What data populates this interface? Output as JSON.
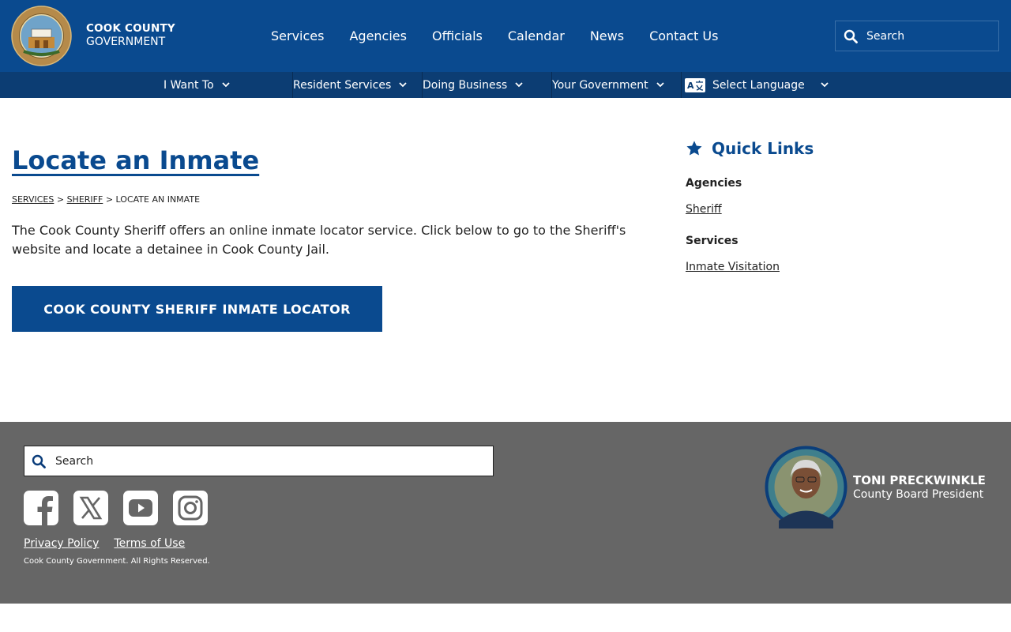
{
  "header": {
    "brand_line1": "COOK COUNTY",
    "brand_line2": "GOVERNMENT",
    "nav": [
      "Services",
      "Agencies",
      "Officials",
      "Calendar",
      "News",
      "Contact Us"
    ],
    "search_placeholder": "Search"
  },
  "subnav": {
    "items": [
      "I Want To",
      "Resident Services",
      "Doing Business",
      "Your Government"
    ],
    "language": "Select Language"
  },
  "main": {
    "title": "Locate an Inmate",
    "breadcrumb": {
      "services": "SERVICES",
      "sep": ">",
      "sheriff": "SHERIFF",
      "current": "LOCATE AN INMATE"
    },
    "intro": "The Cook County Sheriff offers an online inmate locator service. Click below to go to the Sheriff's website and locate a detainee in Cook County Jail.",
    "cta_label": "COOK COUNTY SHERIFF INMATE LOCATOR"
  },
  "quick_links": {
    "title": "Quick Links",
    "agencies_heading": "Agencies",
    "agencies_link": "Sheriff",
    "services_heading": "Services",
    "services_link": "Inmate Visitation"
  },
  "footer": {
    "search_placeholder": "Search",
    "links": [
      "Privacy Policy",
      "Terms of Use"
    ],
    "copyright": "Cook County Government. All Rights Reserved.",
    "president_name": "TONI PRECKWINKLE",
    "president_title": "County Board President"
  },
  "colors": {
    "primary": "#0a4a8f",
    "subnav": "#0c3d73",
    "footer": "#666666"
  }
}
